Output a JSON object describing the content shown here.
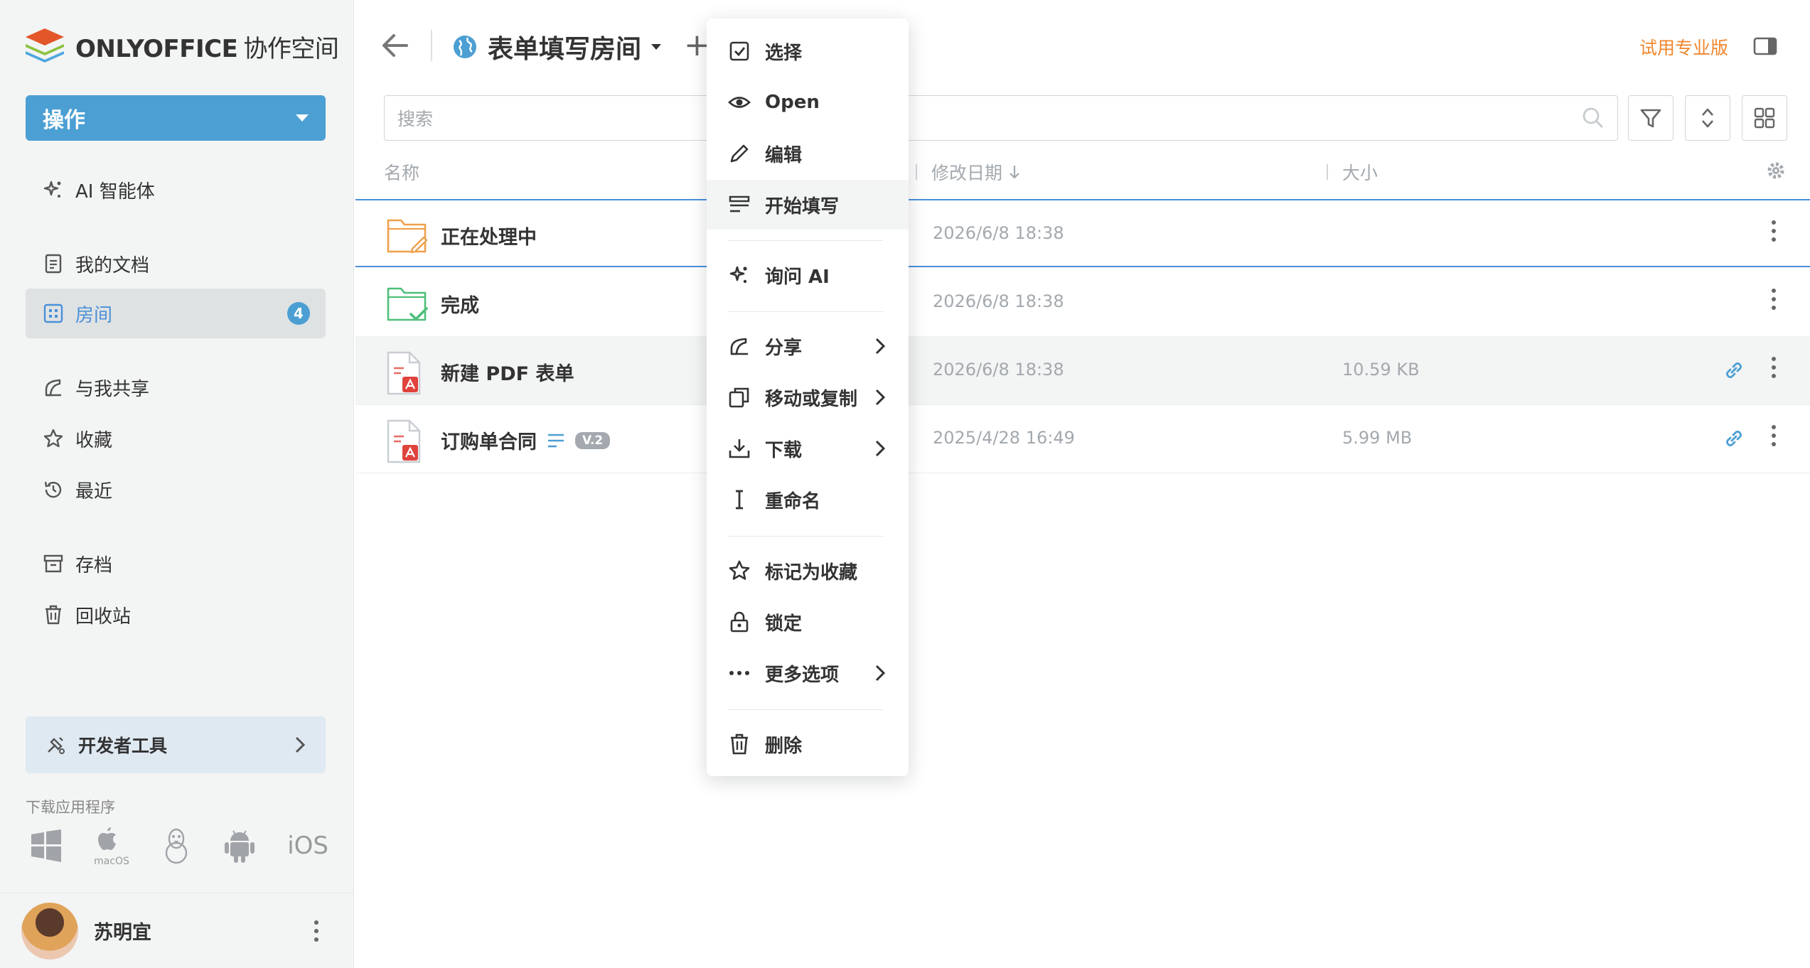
{
  "brand": {
    "name": "ONLYOFFICE",
    "sub": "协作空间"
  },
  "sidebar": {
    "action_label": "操作",
    "items": [
      {
        "label": "AI 智能体"
      },
      {
        "label": "我的文档"
      },
      {
        "label": "房间",
        "badge": "4"
      },
      {
        "label": "与我共享"
      },
      {
        "label": "收藏"
      },
      {
        "label": "最近"
      },
      {
        "label": "存档"
      },
      {
        "label": "回收站"
      }
    ],
    "devtools_label": "开发者工具",
    "download_title": "下载应用程序",
    "apps": {
      "macos": "macOS",
      "ios": "iOS"
    },
    "user_name": "苏明宜"
  },
  "header": {
    "room_title": "表单填写房间",
    "trial_label": "试用专业版"
  },
  "search": {
    "placeholder": "搜索"
  },
  "table": {
    "headers": {
      "name": "名称",
      "modified": "修改日期",
      "size": "大小"
    },
    "rows": [
      {
        "name": "正在处理中",
        "modified": "2026/6/8 18:38",
        "size": ""
      },
      {
        "name": "完成",
        "modified": "2026/6/8 18:38",
        "size": ""
      },
      {
        "name": "新建 PDF 表单",
        "modified": "2026/6/8 18:38",
        "size": "10.59 KB"
      },
      {
        "name": "订购单合同",
        "version": "V.2",
        "modified": "2025/4/28 16:49",
        "size": "5.99 MB"
      }
    ]
  },
  "context_menu": {
    "items": [
      {
        "label": "选择"
      },
      {
        "label": "Open"
      },
      {
        "label": "编辑"
      },
      {
        "label": "开始填写"
      },
      {
        "label": "询问 AI"
      },
      {
        "label": "分享"
      },
      {
        "label": "移动或复制"
      },
      {
        "label": "下载"
      },
      {
        "label": "重命名"
      },
      {
        "label": "标记为收藏"
      },
      {
        "label": "锁定"
      },
      {
        "label": "更多选项"
      },
      {
        "label": "删除"
      }
    ]
  },
  "colors": {
    "accent": "#4c9fd3",
    "trial": "#f0862e",
    "muted": "#a3a9ae"
  }
}
